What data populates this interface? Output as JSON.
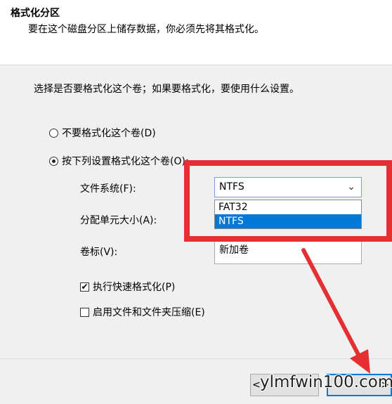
{
  "header": {
    "title": "格式化分区",
    "subtitle": "要在这个磁盘分区上储存数据，你必须先将其格式化。"
  },
  "main": {
    "prompt": "选择是否要格式化这个卷；如果要格式化，要使用什么设置。",
    "radio_no_format": "不要格式化这个卷(D)",
    "radio_format": "按下列设置格式化这个卷(O):",
    "file_system_label": "文件系统(F):",
    "file_system_value": "NTFS",
    "file_system_options": [
      "FAT32",
      "NTFS"
    ],
    "allocation_label": "分配单元大小(A):",
    "volume_label_label": "卷标(V):",
    "volume_label_value": "新加卷",
    "quick_format_label": "执行快速格式化(P)",
    "quick_format_checked": true,
    "compression_label": "启用文件和文件夹压缩(E)",
    "compression_checked": false
  },
  "footer": {
    "back_label": "<",
    "next_label": ">"
  },
  "watermark": "ylmfwin100.com",
  "colors": {
    "highlight": "#e53033",
    "selection": "#0078d7"
  }
}
